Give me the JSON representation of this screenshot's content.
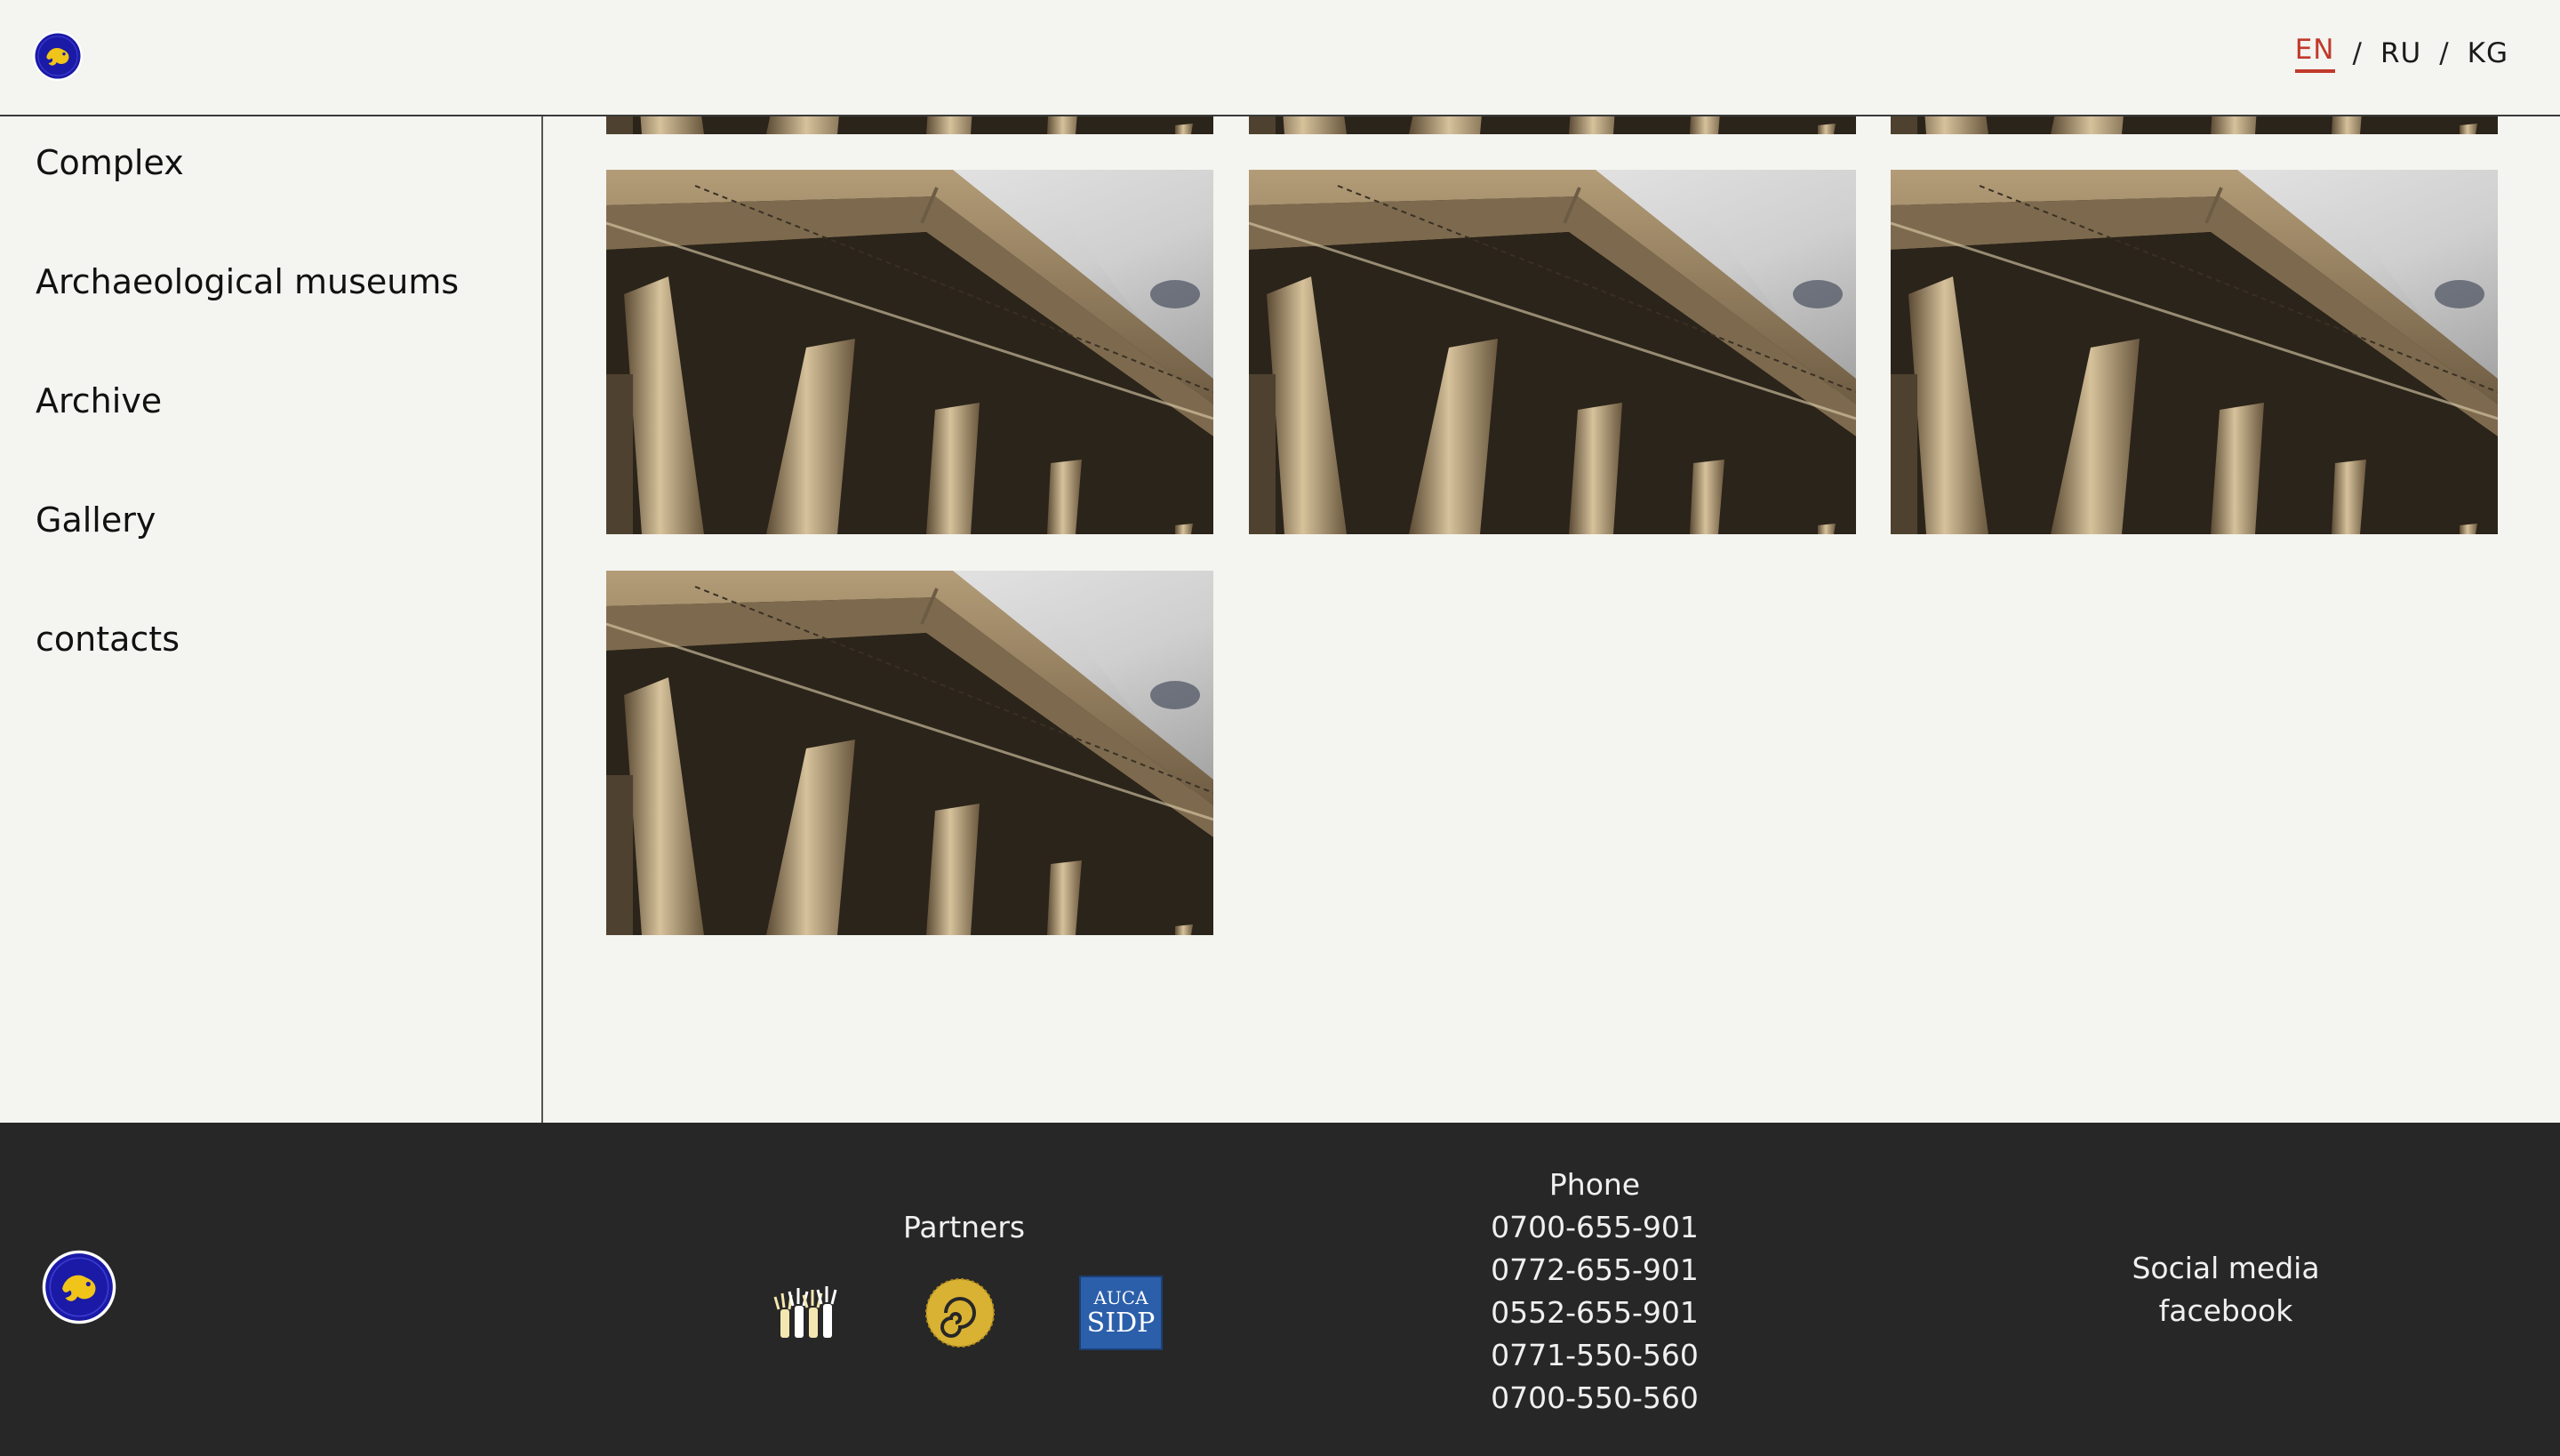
{
  "header": {
    "logo": "museum-logo",
    "languages": [
      {
        "label": "EN",
        "active": true
      },
      {
        "label": "RU",
        "active": false
      },
      {
        "label": "KG",
        "active": false
      }
    ],
    "separator": "/"
  },
  "sidebar": {
    "items": [
      {
        "label": "Complex"
      },
      {
        "label": "Archaeological museums"
      },
      {
        "label": "Archive"
      },
      {
        "label": "Gallery"
      },
      {
        "label": "contacts"
      }
    ]
  },
  "gallery": {
    "image": "classical-building-columns-photo",
    "visible_full_photos": 4,
    "partially_visible_photos": 3
  },
  "footer": {
    "partners_title": "Partners",
    "partners": [
      {
        "icon": "raised-hands-logo"
      },
      {
        "icon": "golden-spiral-logo"
      },
      {
        "icon": "auca-sidp-logo",
        "line1": "AUCA",
        "line2": "SIDP"
      }
    ],
    "phone_title": "Phone",
    "phones": [
      "0700-655-901",
      "0772-655-901",
      "0552-655-901",
      "0771-550-560",
      "0700-550-560"
    ],
    "social_title": "Social media",
    "social_link": "facebook"
  },
  "colors": {
    "background": "#f4f4f0",
    "footer": "#272727",
    "accent": "#c0392b",
    "logo_blue": "#1a1aa6",
    "logo_gold": "#f0c419"
  }
}
